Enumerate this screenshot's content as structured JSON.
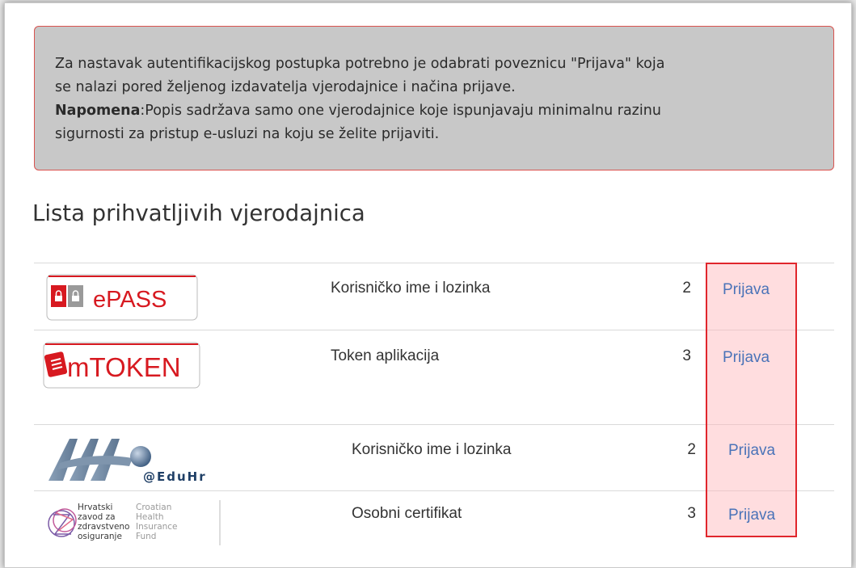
{
  "notice": {
    "line1": "Za nastavak autentifikacijskog postupka potrebno je odabrati poveznicu \"Prijava\" koja",
    "line2": "se nalazi pored željenog izdavatelja vjerodajnice i načina prijave.",
    "note_label": "Napomena",
    "line3": ":Popis sadržava samo one vjerodajnice koje ispunjavaju minimalnu razinu",
    "line4": "sigurnosti za pristup e-usluzi na koju se želite prijaviti."
  },
  "title": "Lista prihvatljivih vjerodajnica",
  "credentials": [
    {
      "logo_text": "ePASS",
      "logo_icon": "padlock-icon",
      "method": "Korisničko ime i lozinka",
      "level": "2",
      "link": "Prijava"
    },
    {
      "logo_text": "mTOKEN",
      "logo_icon": "phone-icon",
      "method": "Token aplikacija",
      "level": "3",
      "link": "Prijava"
    },
    {
      "logo_text": "@EduHr",
      "logo_icon": "aai-wave-icon",
      "method": "Korisničko ime i lozinka",
      "level": "2",
      "link": "Prijava"
    },
    {
      "logo_lines_hr": [
        "Hrvatski",
        "zavod za",
        "zdravstveno",
        "osiguranje"
      ],
      "logo_lines_en": [
        "Croatian",
        "Health",
        "Insurance",
        "Fund"
      ],
      "logo_icon": "hzzo-emblem-icon",
      "method": "Osobni certifikat",
      "level": "3",
      "link": "Prijava"
    }
  ],
  "colors": {
    "accent_link": "#4a73b8",
    "alert_border": "#d9534f",
    "highlight_border": "#e0262c",
    "brand_red": "#d71920"
  }
}
